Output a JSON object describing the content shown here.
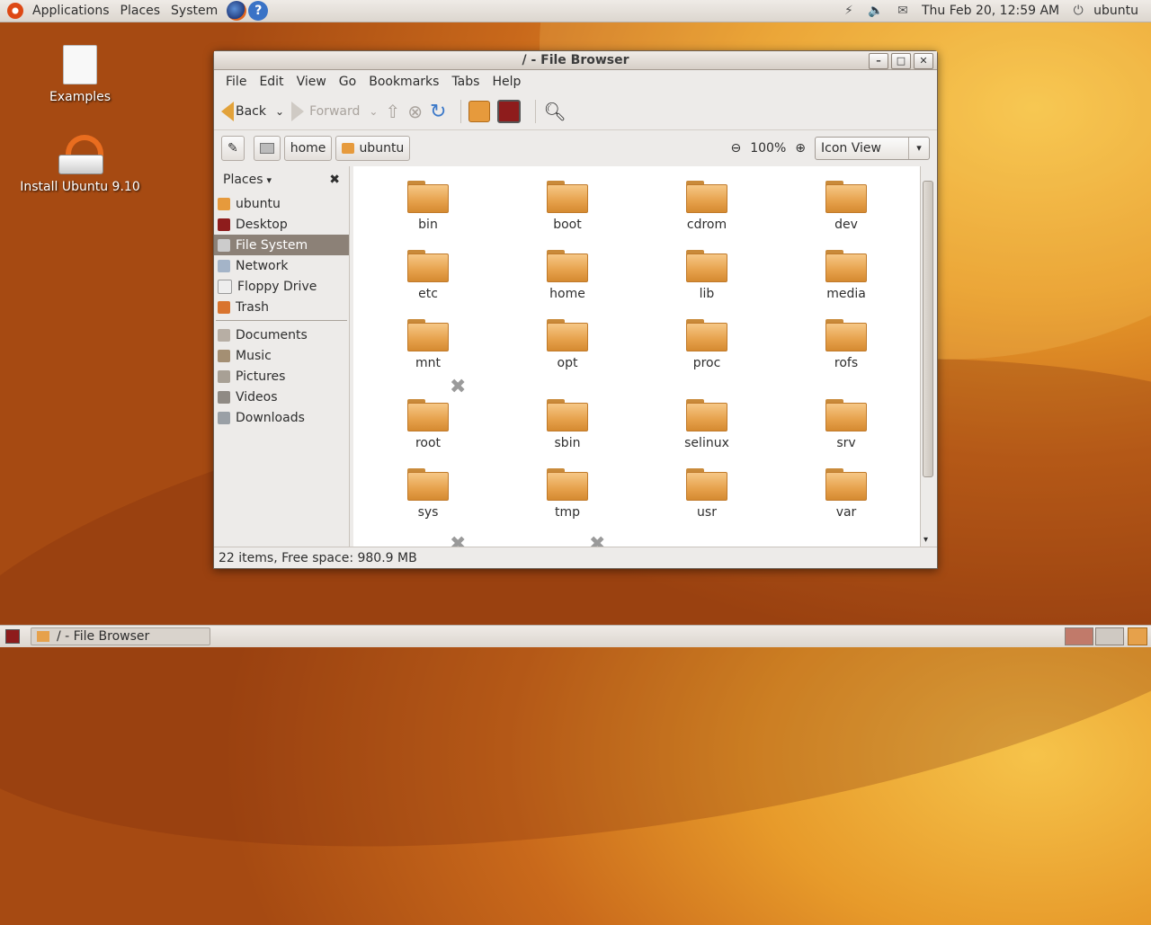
{
  "top_panel": {
    "menus": [
      "Applications",
      "Places",
      "System"
    ],
    "clock": "Thu Feb 20, 12:59 AM",
    "user": "ubuntu",
    "icons": [
      "ubuntu-logo-icon",
      "firefox-icon",
      "help-icon",
      "network-icon",
      "volume-icon",
      "mail-icon",
      "power-icon"
    ]
  },
  "desktop": {
    "icons": [
      {
        "label": "Examples",
        "icon": "document-icon"
      },
      {
        "label": "Install Ubuntu 9.10",
        "icon": "installer-icon"
      }
    ]
  },
  "window": {
    "title": "/ - File Browser",
    "menus": [
      "File",
      "Edit",
      "View",
      "Go",
      "Bookmarks",
      "Tabs",
      "Help"
    ],
    "toolbar": {
      "back": "Back",
      "forward": "Forward"
    },
    "location": {
      "crumbs": [
        "home",
        "ubuntu"
      ],
      "zoom": "100%",
      "view_mode": "Icon View"
    },
    "sidebar": {
      "header": "Places",
      "places": [
        {
          "label": "ubuntu",
          "icon": "home-folder-icon",
          "selected": false
        },
        {
          "label": "Desktop",
          "icon": "desktop-icon",
          "selected": false
        },
        {
          "label": "File System",
          "icon": "harddisk-icon",
          "selected": true
        },
        {
          "label": "Network",
          "icon": "network-icon",
          "selected": false
        },
        {
          "label": "Floppy Drive",
          "icon": "floppy-icon",
          "selected": false
        },
        {
          "label": "Trash",
          "icon": "trash-icon",
          "selected": false
        }
      ],
      "bookmarks": [
        {
          "label": "Documents",
          "icon": "folder-icon"
        },
        {
          "label": "Music",
          "icon": "music-folder-icon"
        },
        {
          "label": "Pictures",
          "icon": "pictures-folder-icon"
        },
        {
          "label": "Videos",
          "icon": "videos-folder-icon"
        },
        {
          "label": "Downloads",
          "icon": "downloads-folder-icon"
        }
      ]
    },
    "folders": [
      {
        "name": "bin"
      },
      {
        "name": "boot"
      },
      {
        "name": "cdrom"
      },
      {
        "name": "dev"
      },
      {
        "name": "etc"
      },
      {
        "name": "home"
      },
      {
        "name": "lib"
      },
      {
        "name": "media"
      },
      {
        "name": "mnt"
      },
      {
        "name": "opt"
      },
      {
        "name": "proc"
      },
      {
        "name": "rofs"
      },
      {
        "name": "root",
        "locked": true
      },
      {
        "name": "sbin"
      },
      {
        "name": "selinux"
      },
      {
        "name": "srv"
      },
      {
        "name": "sys"
      },
      {
        "name": "tmp"
      },
      {
        "name": "usr"
      },
      {
        "name": "var"
      }
    ],
    "status": "22 items, Free space: 980.9 MB"
  },
  "bottom_panel": {
    "task": "/ - File Browser"
  }
}
